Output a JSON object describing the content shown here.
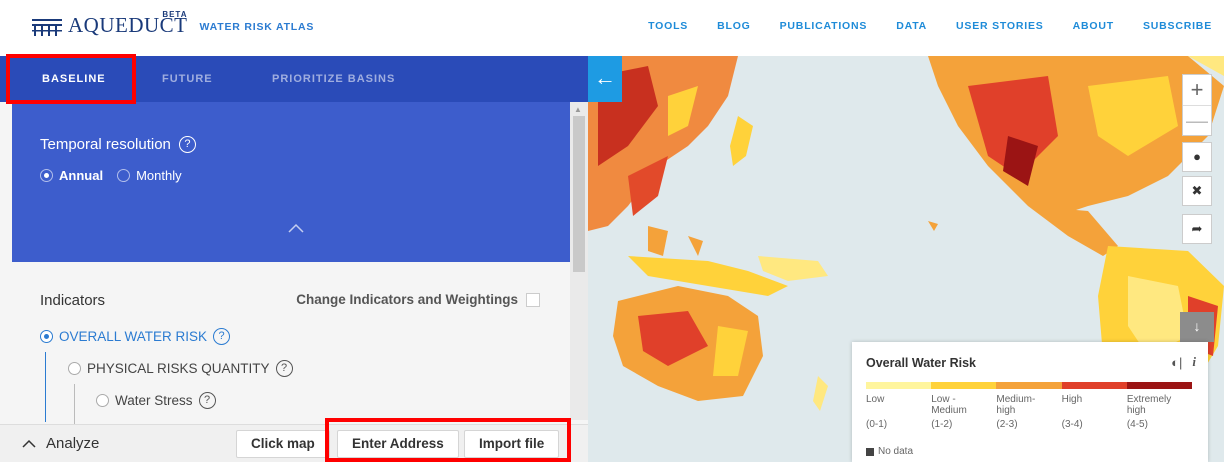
{
  "header": {
    "logo_text": "AQUEDUCT",
    "beta": "BETA",
    "subtitle": "WATER RISK ATLAS",
    "nav": [
      "TOOLS",
      "BLOG",
      "PUBLICATIONS",
      "DATA",
      "USER STORIES",
      "ABOUT",
      "SUBSCRIBE"
    ]
  },
  "tabs": [
    "BASELINE",
    "FUTURE",
    "PRIORITIZE BASINS"
  ],
  "temporal": {
    "label": "Temporal resolution",
    "help": "?",
    "options": [
      "Annual",
      "Monthly"
    ],
    "selected": "Annual"
  },
  "indicators": {
    "label": "Indicators",
    "change_label": "Change Indicators and Weightings",
    "items": [
      {
        "label": "OVERALL WATER RISK",
        "help": "?"
      },
      {
        "label": "PHYSICAL RISKS QUANTITY",
        "help": "?"
      },
      {
        "label": "Water Stress",
        "help": "?"
      }
    ]
  },
  "analyze": {
    "label": "Analyze",
    "buttons": [
      "Click map",
      "Enter Address",
      "Import file"
    ]
  },
  "map": {
    "back_icon": "arrow-left-icon",
    "zoom_in": "+",
    "zoom_out": "—",
    "legend": {
      "title": "Overall Water Risk",
      "categories": [
        {
          "label": "Low",
          "range": "(0-1)",
          "color": "#fff59d"
        },
        {
          "label": "Low - Medium",
          "range": "(1-2)",
          "color": "#ffd23a"
        },
        {
          "label": "Medium- high",
          "range": "(2-3)",
          "color": "#f4a23a"
        },
        {
          "label": "High",
          "range": "(3-4)",
          "color": "#e0402a"
        },
        {
          "label": "Extremely high",
          "range": "(4-5)",
          "color": "#9b1414"
        }
      ],
      "no_data": "No data"
    }
  },
  "colors": {
    "tab_bar": "#2a4bb8",
    "panel_blue": "#3d5dcc",
    "accent": "#2b7bd1",
    "highlight": "#ff0000"
  }
}
